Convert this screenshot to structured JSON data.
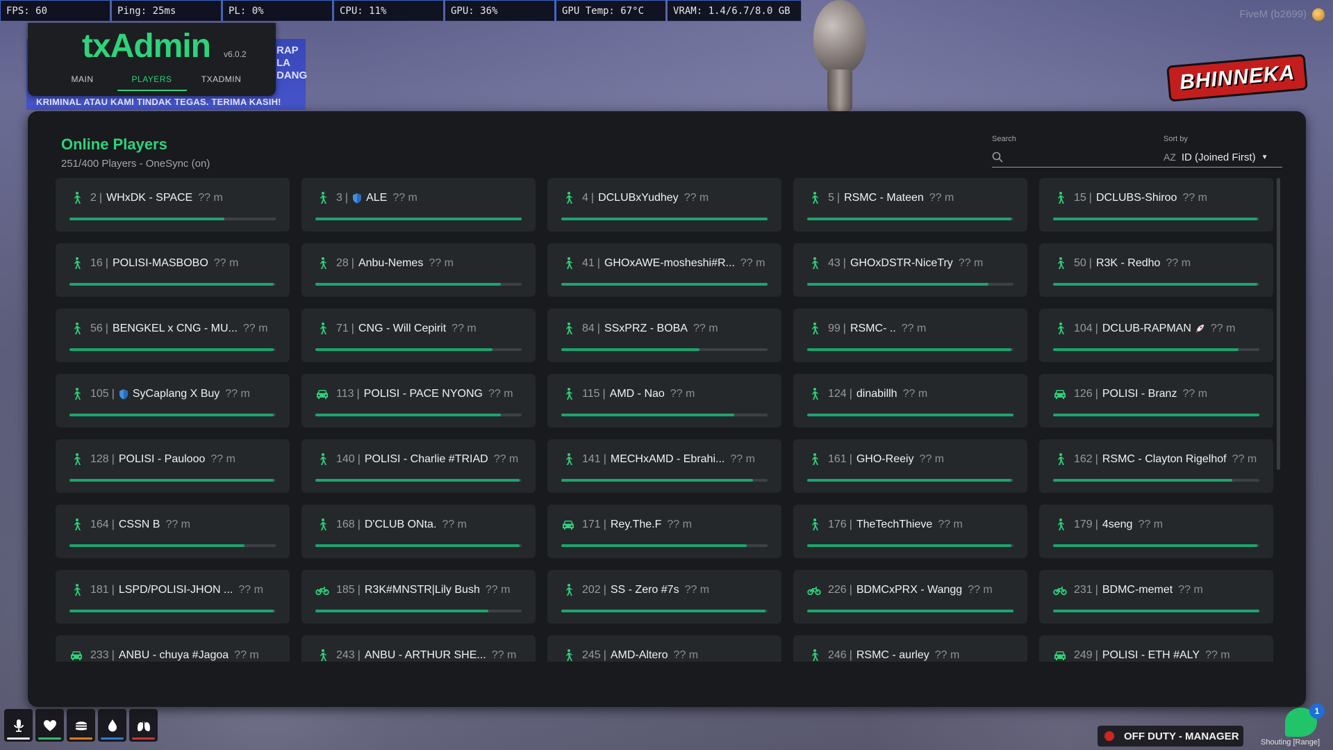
{
  "perf": [
    {
      "label": "FPS: 60"
    },
    {
      "label": "Ping: 25ms"
    },
    {
      "label": "PL: 0%"
    },
    {
      "label": "CPU: 11%"
    },
    {
      "label": "GPU: 36%"
    },
    {
      "label": "GPU Temp: 67°C"
    },
    {
      "label": "VRAM: 1.4/6.7/8.0 GB"
    }
  ],
  "fivem_label": "FiveM (b2699)",
  "banner": {
    "side": "RAP\nLA\nDANG",
    "text": "KRIMINAL ATAU KAMI TINDAK TEGAS. TERIMA KASIH!"
  },
  "server_logo": "BHINNEKA",
  "txadmin": {
    "logo": "txAdmin",
    "version": "v6.0.2",
    "tabs": [
      "MAIN",
      "PLAYERS",
      "TXADMIN"
    ],
    "active_tab": 1
  },
  "panel": {
    "title": "Online Players",
    "subtitle": "251/400 Players - OneSync (on)",
    "search_label": "Search",
    "search_value": "",
    "sort_label": "Sort by",
    "sort_value": "ID (Joined First)",
    "sort_icon": "AZ"
  },
  "players": [
    {
      "id": "2",
      "name": "WHxDK - SPACE",
      "dist": "?? m",
      "icon": "walk",
      "health": 0.75
    },
    {
      "id": "3",
      "name": "ALE",
      "dist": "?? m",
      "icon": "walk",
      "badge": "shield",
      "health": 1.0
    },
    {
      "id": "4",
      "name": "DCLUBxYudhey",
      "dist": "?? m",
      "icon": "walk",
      "health": 1.0
    },
    {
      "id": "5",
      "name": "RSMC - Mateen",
      "dist": "?? m",
      "icon": "walk",
      "health": 0.99
    },
    {
      "id": "15",
      "name": "DCLUBS-Shiroo",
      "dist": "?? m",
      "icon": "walk",
      "health": 0.99
    },
    {
      "id": "16",
      "name": "POLISI-MASBOBO",
      "dist": "?? m",
      "icon": "walk",
      "health": 0.99
    },
    {
      "id": "28",
      "name": "Anbu-Nemes",
      "dist": "?? m",
      "icon": "walk",
      "health": 0.9
    },
    {
      "id": "41",
      "name": "GHOxAWE-mosheshi#R...",
      "dist": "?? m",
      "icon": "walk",
      "health": 1.0
    },
    {
      "id": "43",
      "name": "GHOxDSTR-NiceTry",
      "dist": "?? m",
      "icon": "walk",
      "health": 0.88
    },
    {
      "id": "50",
      "name": "R3K - Redho",
      "dist": "?? m",
      "icon": "walk",
      "health": 0.99
    },
    {
      "id": "56",
      "name": "BENGKEL x CNG - MU...",
      "dist": "?? m",
      "icon": "walk",
      "health": 0.99
    },
    {
      "id": "71",
      "name": "CNG - Will Cepirit",
      "dist": "?? m",
      "icon": "walk",
      "health": 0.86
    },
    {
      "id": "84",
      "name": "SSxPRZ - BOBA",
      "dist": "?? m",
      "icon": "walk",
      "health": 0.67
    },
    {
      "id": "99",
      "name": "RSMC- ..",
      "dist": "?? m",
      "icon": "walk",
      "health": 0.99
    },
    {
      "id": "104",
      "name": "DCLUB-RAPMAN",
      "dist": "?? m",
      "icon": "walk",
      "badge": "rocket",
      "health": 0.9
    },
    {
      "id": "105",
      "name": "SyCaplang X Buy",
      "dist": "?? m",
      "icon": "walk",
      "badge": "shield",
      "health": 0.99
    },
    {
      "id": "113",
      "name": "POLISI - PACE NYONG",
      "dist": "?? m",
      "icon": "car",
      "health": 0.9
    },
    {
      "id": "115",
      "name": "AMD - Nao",
      "dist": "?? m",
      "icon": "walk",
      "health": 0.84
    },
    {
      "id": "124",
      "name": "dinabillh",
      "dist": "?? m",
      "icon": "walk",
      "health": 1.0
    },
    {
      "id": "126",
      "name": "POLISI - Branz",
      "dist": "?? m",
      "icon": "car",
      "health": 1.0
    },
    {
      "id": "128",
      "name": "POLISI - Paulooo",
      "dist": "?? m",
      "icon": "walk",
      "health": 0.99
    },
    {
      "id": "140",
      "name": "POLISI - Charlie #TRIAD",
      "dist": "?? m",
      "icon": "walk",
      "health": 0.99
    },
    {
      "id": "141",
      "name": "MECHxAMD - Ebrahi...",
      "dist": "?? m",
      "icon": "walk",
      "health": 0.93
    },
    {
      "id": "161",
      "name": "GHO-Reeiy",
      "dist": "?? m",
      "icon": "walk",
      "health": 0.99
    },
    {
      "id": "162",
      "name": "RSMC - Clayton Rigelhof",
      "dist": "?? m",
      "icon": "walk",
      "health": 0.87
    },
    {
      "id": "164",
      "name": "CSSN B",
      "dist": "?? m",
      "icon": "walk",
      "health": 0.85
    },
    {
      "id": "168",
      "name": "D'CLUB ONta.",
      "dist": "?? m",
      "icon": "walk",
      "health": 0.99
    },
    {
      "id": "171",
      "name": "Rey.The.F",
      "dist": "?? m",
      "icon": "car",
      "health": 0.9
    },
    {
      "id": "176",
      "name": "TheTechThieve",
      "dist": "?? m",
      "icon": "walk",
      "health": 0.99
    },
    {
      "id": "179",
      "name": "4seng",
      "dist": "?? m",
      "icon": "walk",
      "health": 0.99
    },
    {
      "id": "181",
      "name": "LSPD/POLISI-JHON ...",
      "dist": "?? m",
      "icon": "walk",
      "health": 0.99
    },
    {
      "id": "185",
      "name": "R3K#MNSTR|Lily Bush",
      "dist": "?? m",
      "icon": "bike",
      "health": 0.84
    },
    {
      "id": "202",
      "name": "SS - Zero #7s",
      "dist": "?? m",
      "icon": "walk",
      "health": 0.99
    },
    {
      "id": "226",
      "name": "BDMCxPRX - Wangg",
      "dist": "?? m",
      "icon": "bike",
      "health": 1.0
    },
    {
      "id": "231",
      "name": "BDMC-memet",
      "dist": "?? m",
      "icon": "bike",
      "health": 1.0
    },
    {
      "id": "233",
      "name": "ANBU - chuya #Jagoa",
      "dist": "?? m",
      "icon": "car",
      "health": 0.99
    },
    {
      "id": "243",
      "name": "ANBU - ARTHUR SHE...",
      "dist": "?? m",
      "icon": "walk",
      "health": 0.99
    },
    {
      "id": "245",
      "name": "AMD-Altero",
      "dist": "?? m",
      "icon": "walk",
      "health": 0.99
    },
    {
      "id": "246",
      "name": "RSMC - aurley",
      "dist": "?? m",
      "icon": "walk",
      "health": 0.99
    },
    {
      "id": "249",
      "name": "POLISI - ETH #ALY",
      "dist": "?? m",
      "icon": "car",
      "health": 0.99
    }
  ],
  "hud": [
    {
      "name": "microphone-icon",
      "color": "#e8e8e8",
      "level": 1.0
    },
    {
      "name": "heart-icon",
      "color": "#2fbf71",
      "level": 1.0
    },
    {
      "name": "burger-icon",
      "color": "#e07c1f",
      "level": 1.0
    },
    {
      "name": "water-drop-icon",
      "color": "#2e7ed6",
      "level": 1.0
    },
    {
      "name": "lungs-icon",
      "color": "#c43a3a",
      "level": 1.0
    }
  ],
  "duty_label": "OFF DUTY - MANAGER",
  "chat_badge": "1",
  "voice_mode": "Shouting [Range]",
  "colors": {
    "accent": "#2ed37a",
    "bar": "#1aa56c",
    "panel": "#181a1d",
    "card": "#25282b"
  }
}
